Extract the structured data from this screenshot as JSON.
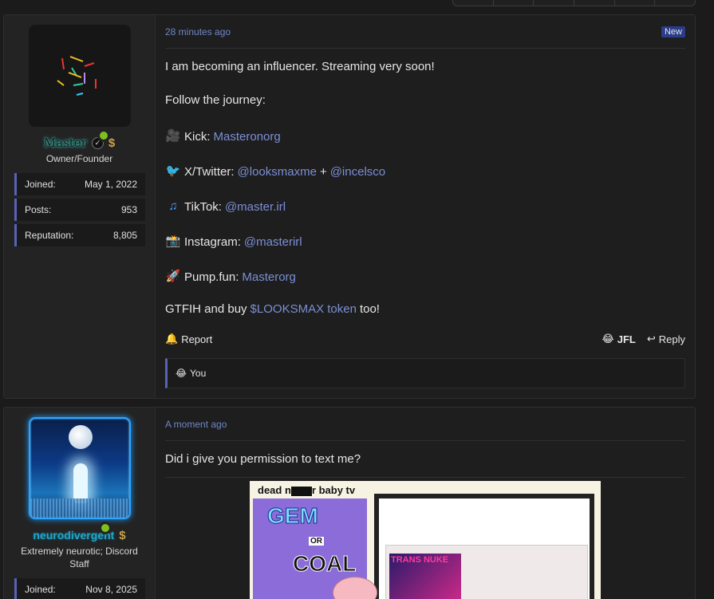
{
  "posts": [
    {
      "user": {
        "name": "Master",
        "title": "Owner/Founder",
        "stats": [
          {
            "label": "Joined:",
            "value": "May 1, 2022"
          },
          {
            "label": "Posts:",
            "value": "953"
          },
          {
            "label": "Reputation:",
            "value": "8,805"
          }
        ]
      },
      "timestamp": "28 minutes ago",
      "badge": "New",
      "body": {
        "line1": "I am becoming an influencer. Streaming very soon!",
        "line2": "Follow the journey:",
        "kick_label": "Kick:",
        "kick_link": "Masteronorg",
        "x_label": "X/Twitter:",
        "x_link1": "@looksmaxme",
        "x_plus": "+",
        "x_link2": "@incelsco",
        "tiktok_label": "TikTok:",
        "tiktok_link": "@master.irl",
        "insta_label": "Instagram:",
        "insta_link": "@masterirl",
        "pump_label": "Pump.fun:",
        "pump_link": "Masterorg",
        "last_pre": "GTFIH and buy",
        "last_link": "$LOOKSMAX token",
        "last_post": "too!"
      },
      "actions": {
        "report": "Report",
        "jfl": "JFL",
        "reply": "Reply"
      },
      "reactions": "You"
    },
    {
      "user": {
        "name": "neurodivergent",
        "title": "Extremely neurotic; Discord Staff",
        "stats": [
          {
            "label": "Joined:",
            "value": "Nov 8, 2025"
          }
        ]
      },
      "timestamp": "A moment ago",
      "body": {
        "line1": "Did i give you permission to text me?"
      },
      "meme": {
        "title_pre": "dead n",
        "title_post": "r baby tv",
        "gem": "GEM",
        "or": "OR",
        "coal": "COAL",
        "thread_title": "TRANS NUKE"
      }
    }
  ],
  "colors": {
    "accent": "#5863b8",
    "link": "#7b8fd6",
    "online": "#7cc11f",
    "badge": "#2b3c8a"
  },
  "icons": {
    "kick": "movie-camera-icon",
    "x": "bird-icon",
    "tiktok": "music-note-icon",
    "instagram": "camera-flash-icon",
    "pump": "rocket-icon",
    "report": "bell-icon",
    "jfl": "laughing-face-icon",
    "reply": "reply-arrow-icon"
  }
}
